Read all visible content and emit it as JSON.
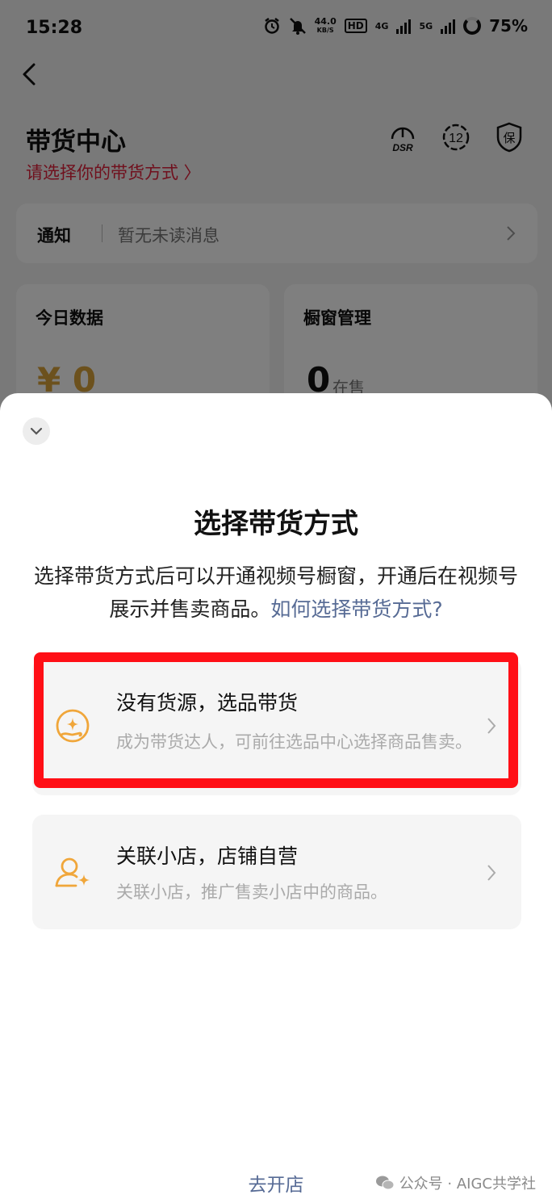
{
  "status_bar": {
    "time": "15:28",
    "net_speed_value": "44.0",
    "net_speed_unit": "KB/S",
    "hd_label": "HD",
    "hd_sub": "1 2",
    "net_4g": "4G",
    "net_5g": "5G",
    "battery": "75%"
  },
  "header": {
    "title": "带货中心",
    "subtitle": "请选择你的带货方式 〉",
    "icons": [
      "dsr-icon",
      "level-12-icon",
      "shield-guarantee-icon"
    ],
    "dsr_label": "DSR",
    "level_label": "12",
    "guarantee_label": "保"
  },
  "notice": {
    "label": "通知",
    "text": "暂无未读消息"
  },
  "cards": {
    "today_label": "今日数据",
    "today_value": "¥ 0",
    "window_label": "橱窗管理",
    "window_value": "0",
    "window_unit": "在售"
  },
  "sheet": {
    "title": "选择带货方式",
    "desc": "选择带货方式后可以开通视频号橱窗，开通后在视频号展示并售卖商品。",
    "link": "如何选择带货方式?",
    "options": [
      {
        "title": "没有货源，选品带货",
        "desc": "成为带货达人，可前往选品中心选择商品售卖。",
        "icon": "hand-sparkle-icon"
      },
      {
        "title": "关联小店，店铺自营",
        "desc": "关联小店，推广售卖小店中的商品。",
        "icon": "user-sparkle-icon"
      }
    ],
    "open_shop": "去开店"
  },
  "watermark": {
    "text": "公众号 · AIGC共学社"
  },
  "colors": {
    "accent_red": "#e0203a",
    "link_blue": "#576b95",
    "icon_orange": "#f0a63a",
    "highlight_red": "#ff0f16"
  }
}
